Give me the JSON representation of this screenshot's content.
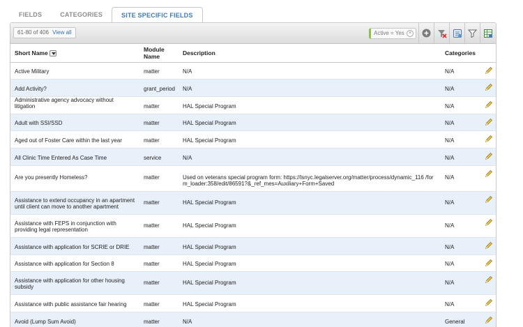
{
  "tabs": [
    {
      "label": "FIELDS"
    },
    {
      "label": "CATEGORIES"
    },
    {
      "label": "SITE SPECIFIC FIELDS"
    }
  ],
  "toolbar": {
    "range": "61-80 of 406",
    "view_all": "View all",
    "filter_chip": "Active = Yes",
    "icons": [
      "add-icon",
      "clear-filter-icon",
      "export-icon",
      "filter-icon",
      "spreadsheet-icon"
    ]
  },
  "table": {
    "headers": {
      "short_name": "Short Name",
      "module_name": "Module Name",
      "description": "Description",
      "categories": "Categories"
    },
    "rows": [
      {
        "short_name": "Active Military",
        "module": "matter",
        "description": "N/A",
        "categories": "N/A"
      },
      {
        "short_name": "Add Activity?",
        "module": "grant_period",
        "description": "N/A",
        "categories": "N/A"
      },
      {
        "short_name": "Administrative agency advocacy without litigation",
        "module": "matter",
        "description": "HAL Special Program",
        "categories": "N/A"
      },
      {
        "short_name": "Adult with SSI/SSD",
        "module": "matter",
        "description": "HAL Special Program",
        "categories": "N/A"
      },
      {
        "short_name": "Aged out of Foster Care within the last year",
        "module": "matter",
        "description": "HAL Special Program",
        "categories": "N/A"
      },
      {
        "short_name": "All Clinic Time Entered As Case Time",
        "module": "service",
        "description": "N/A",
        "categories": "N/A"
      },
      {
        "short_name": "Are you presently Homeless?",
        "module": "matter",
        "description": "Used on veterans special program form: https://lsnyc.legalserver.org/matter/process/dynamic_116 /form_loader:358/edit/86591?&_ref_mes=Auxiliary+Form+Saved",
        "categories": "N/A"
      },
      {
        "short_name": "Assistance to extend occupancy in an apartment until client can move to another apartment",
        "module": "matter",
        "description": "HAL Special Program",
        "categories": "N/A"
      },
      {
        "short_name": "Assistance with FEPS in conjunction with providing legal representation",
        "module": "matter",
        "description": "HAL Special Program",
        "categories": "N/A"
      },
      {
        "short_name": "Assistance with application for SCRIE or DRIE",
        "module": "matter",
        "description": "HAL Special Program",
        "categories": "N/A"
      },
      {
        "short_name": "Assistance with application for Section 8",
        "module": "matter",
        "description": "HAL Special Program",
        "categories": "N/A"
      },
      {
        "short_name": "Assistance with application for other housing subsidy",
        "module": "matter",
        "description": "HAL Special Program",
        "categories": "N/A"
      },
      {
        "short_name": "Assistance with public assistance fair hearing",
        "module": "matter",
        "description": "HAL Special Program",
        "categories": "N/A"
      },
      {
        "short_name": "Avoid (Lump Sum Avoid)",
        "module": "matter",
        "description": "N/A",
        "categories": "General"
      }
    ]
  }
}
